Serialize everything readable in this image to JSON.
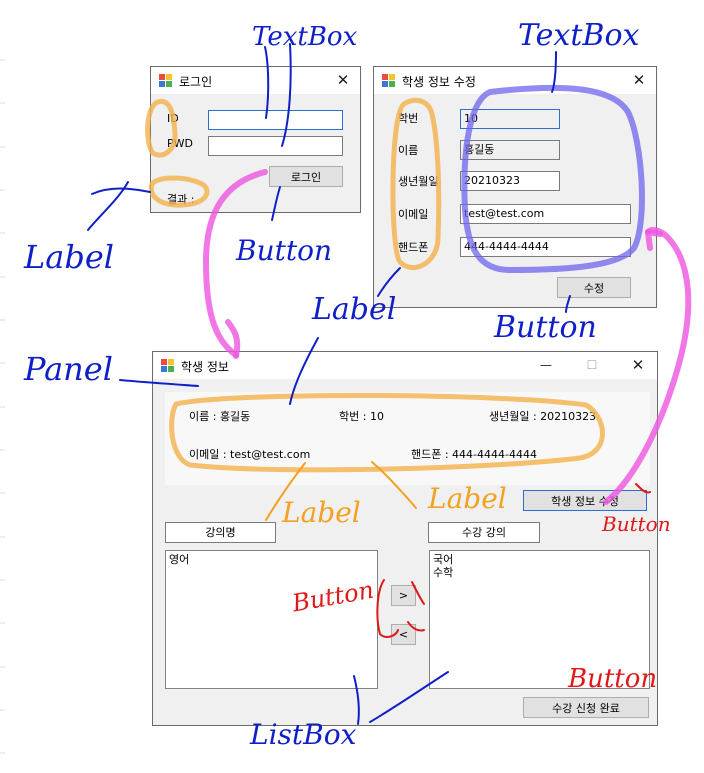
{
  "login_window": {
    "title": "로그인",
    "close_glyph": "✕",
    "id_label": "ID",
    "pwd_label": "PWD",
    "result_label": "결과 :",
    "id_value": "",
    "pwd_value": "",
    "login_button": "로그인"
  },
  "edit_window": {
    "title": "학생 정보 수정",
    "close_glyph": "✕",
    "fields": [
      {
        "label": "학번",
        "value": "10"
      },
      {
        "label": "이름",
        "value": "홍길동"
      },
      {
        "label": "생년월일",
        "value": "20210323"
      },
      {
        "label": "이메일",
        "value": "test@test.com"
      },
      {
        "label": "핸드폰",
        "value": "444-4444-4444"
      }
    ],
    "submit_button": "수정"
  },
  "main_window": {
    "title": "학생 정보",
    "minimize_glyph": "—",
    "maximize_glyph": "☐",
    "close_glyph": "✕",
    "info": {
      "name": "이름 : 홍길동",
      "student_id": "학번 : 10",
      "birth": "생년월일 : 20210323",
      "email": "이메일 : test@test.com",
      "phone": "핸드폰 : 444-4444-4444"
    },
    "edit_button": "학생 정보 수정",
    "course_name_header": "강의명",
    "enrolled_header": "수강 강의",
    "available_courses": [
      "영어"
    ],
    "enrolled_courses": [
      "국어",
      "수학"
    ],
    "move_right_button": ">",
    "move_left_button": "<",
    "complete_button": "수강 신청 완료"
  },
  "annotations": {
    "textbox_top_left": "TextBox",
    "textbox_top_right": "TextBox",
    "label_left": "Label",
    "button_login": "Button",
    "label_center": "Label",
    "button_edit_form": "Button",
    "panel": "Panel",
    "label_orange_1": "Label",
    "label_orange_2": "Label",
    "button_red_right": "Button",
    "button_red_middle": "Button",
    "button_red_bottom": "Button",
    "listbox": "ListBox"
  },
  "colors": {
    "blue_annotation": "#1020c8",
    "orange_highlight": "#f2b14a",
    "magenta_arrow": "#ee55e0",
    "purple_highlight": "#6e66ee",
    "red_annotation": "#e01818",
    "orange_annotation": "#f4a020",
    "window_bg": "#f0f0f0"
  }
}
